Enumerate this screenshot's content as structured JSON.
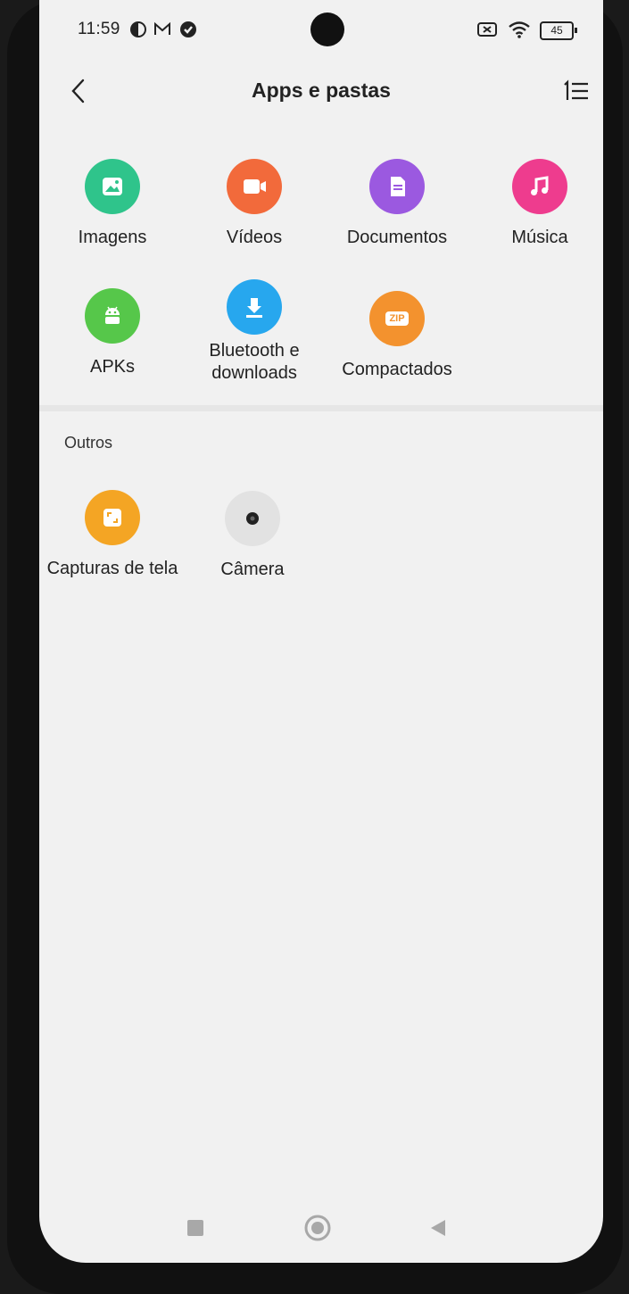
{
  "status_bar": {
    "time": "11:59",
    "battery": "45"
  },
  "header": {
    "title": "Apps e pastas"
  },
  "categories": [
    {
      "label": "Imagens",
      "color": "#2fc48b",
      "icon": "image-icon"
    },
    {
      "label": "Vídeos",
      "color": "#f26a3b",
      "icon": "video-icon"
    },
    {
      "label": "Documentos",
      "color": "#9b59e0",
      "icon": "document-icon"
    },
    {
      "label": "Música",
      "color": "#ee3c8e",
      "icon": "music-icon"
    },
    {
      "label": "APKs",
      "color": "#56c74a",
      "icon": "android-icon"
    },
    {
      "label": "Bluetooth e downloads",
      "color": "#27a7ee",
      "icon": "download-icon"
    },
    {
      "label": "Compactados",
      "color": "#f3922e",
      "icon": "zip-icon",
      "badge": "ZIP"
    }
  ],
  "others": {
    "title": "Outros",
    "items": [
      {
        "label": "Capturas de tela",
        "color": "#f4a524",
        "icon": "screenshot-icon"
      },
      {
        "label": "Câmera",
        "color": "#e2e2e2",
        "icon": "camera-icon"
      }
    ]
  }
}
